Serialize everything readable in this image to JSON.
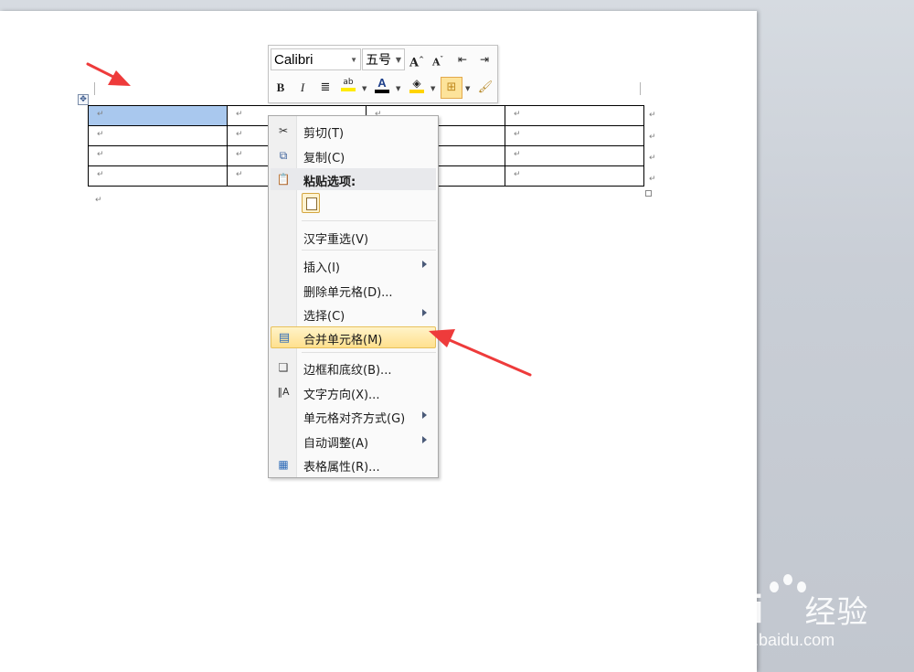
{
  "mini_toolbar": {
    "font_name": "Calibri",
    "font_size": "五号",
    "bold": "B",
    "italic": "I",
    "font_color_letter": "A"
  },
  "table": {
    "rows": 4,
    "cols": 4,
    "cell_marker": "↵",
    "selected_cells": [
      [
        0,
        0
      ]
    ]
  },
  "context_menu": {
    "items": [
      {
        "label": "剪切(T)",
        "icon": "scissors-icon"
      },
      {
        "label": "复制(C)",
        "icon": "copy-icon"
      },
      {
        "label": "粘贴选项:",
        "icon": "paste-icon",
        "header": true
      },
      {
        "label": "汉字重选(V)"
      },
      {
        "label": "插入(I)",
        "submenu": true
      },
      {
        "label": "删除单元格(D)..."
      },
      {
        "label": "选择(C)",
        "submenu": true
      },
      {
        "label": "合并单元格(M)",
        "icon": "merge-cells-icon",
        "highlighted": true
      },
      {
        "label": "边框和底纹(B)...",
        "icon": "borders-icon"
      },
      {
        "label": "文字方向(X)...",
        "icon": "text-direction-icon"
      },
      {
        "label": "单元格对齐方式(G)",
        "submenu": true
      },
      {
        "label": "自动调整(A)",
        "submenu": true
      },
      {
        "label": "表格属性(R)...",
        "icon": "table-properties-icon"
      }
    ]
  },
  "watermark": {
    "logo_text": "Bai",
    "logo_cn": "经验",
    "url": "jingyan.baidu.com"
  },
  "colors": {
    "selection": "#a9c8ee",
    "highlight": "#ffe08e",
    "annotation_arrow": "#ee3b3b"
  }
}
